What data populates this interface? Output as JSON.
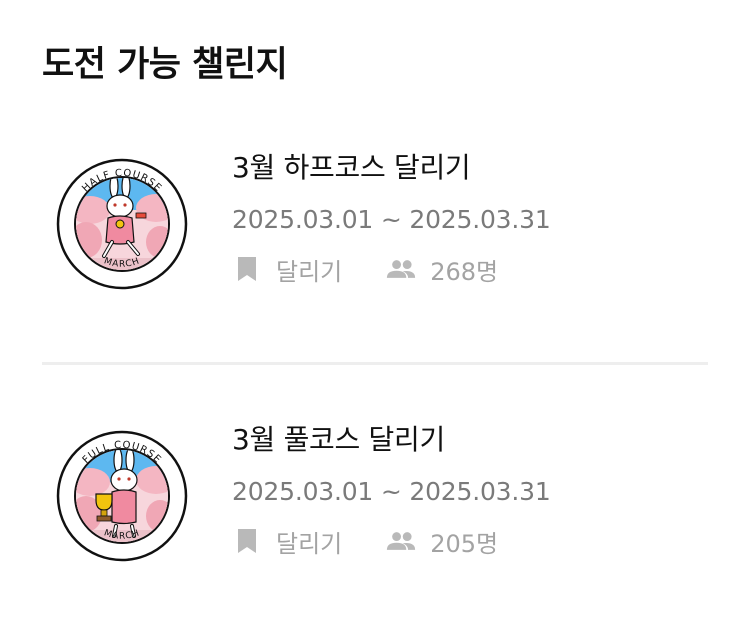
{
  "section": {
    "title": "도전 가능 챌린지"
  },
  "challenges": [
    {
      "title": "3월 하프코스 달리기",
      "dates": "2025.03.01 ~ 2025.03.31",
      "category": "달리기",
      "participants": "268명",
      "badge": {
        "top_text": "HALF COURSE",
        "bottom_text": "MARCH",
        "icon": "rabbit-runner-medal-icon"
      }
    },
    {
      "title": "3월 풀코스 달리기",
      "dates": "2025.03.01 ~ 2025.03.31",
      "category": "달리기",
      "participants": "205명",
      "badge": {
        "top_text": "FULL COURSE",
        "bottom_text": "MARCH",
        "icon": "rabbit-trophy-icon"
      }
    }
  ],
  "icons": {
    "category": "bookmark-icon",
    "participants": "people-icon"
  },
  "colors": {
    "title": "#111111",
    "dates": "#7a7a7a",
    "meta": "#a3a3a3",
    "divider": "#eeeeee",
    "badge_sky": "#5db8f0",
    "badge_blossom": "#f4b6c2"
  }
}
